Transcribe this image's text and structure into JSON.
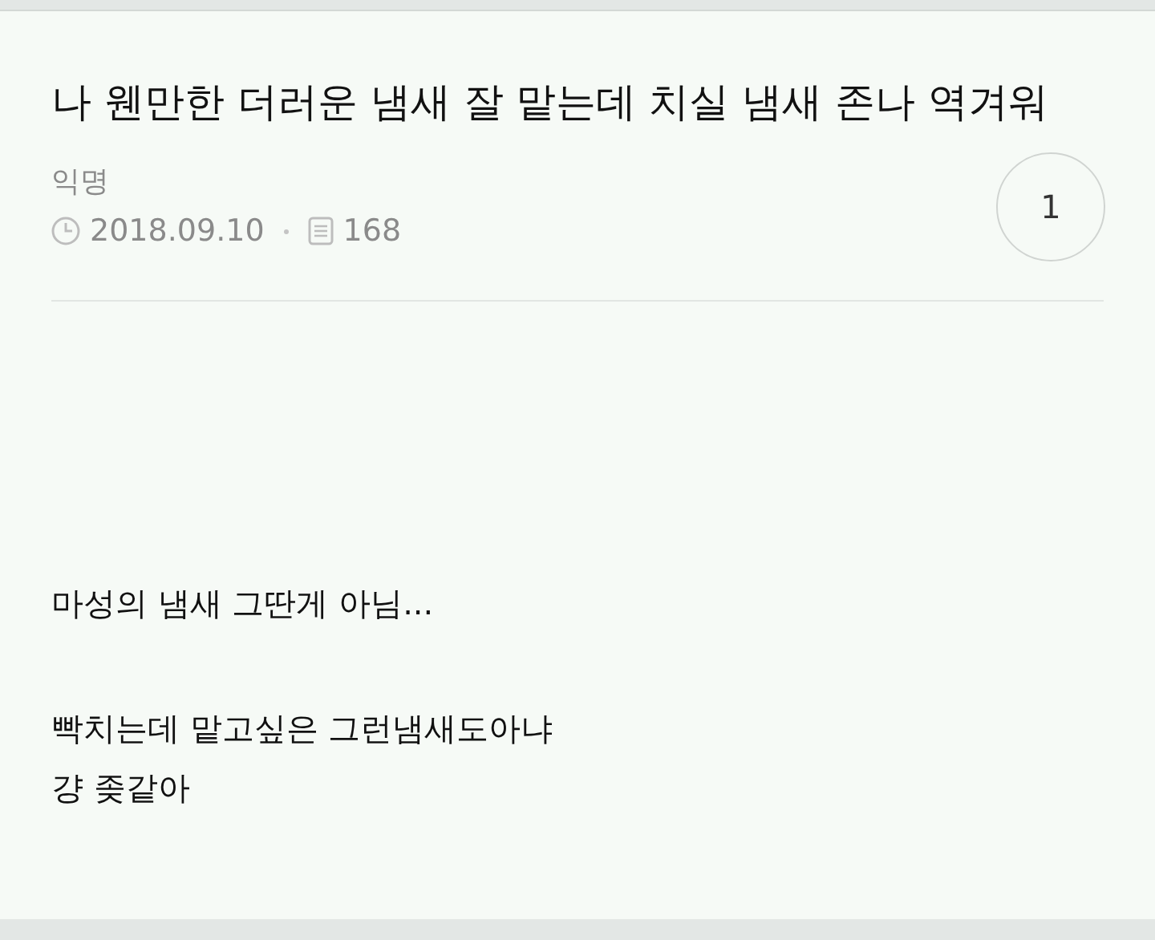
{
  "post": {
    "title": "나 웬만한 더러운 냄새 잘 맡는데 치실 냄새 존나 역겨워",
    "author": "익명",
    "date": "2018.09.10",
    "views": "168",
    "comment_count": "1",
    "body": [
      "마성의 냄새 그딴게 아님...",
      "빡치는데 맡고싶은 그런냄새도아냐\n걍 좆같아"
    ]
  }
}
